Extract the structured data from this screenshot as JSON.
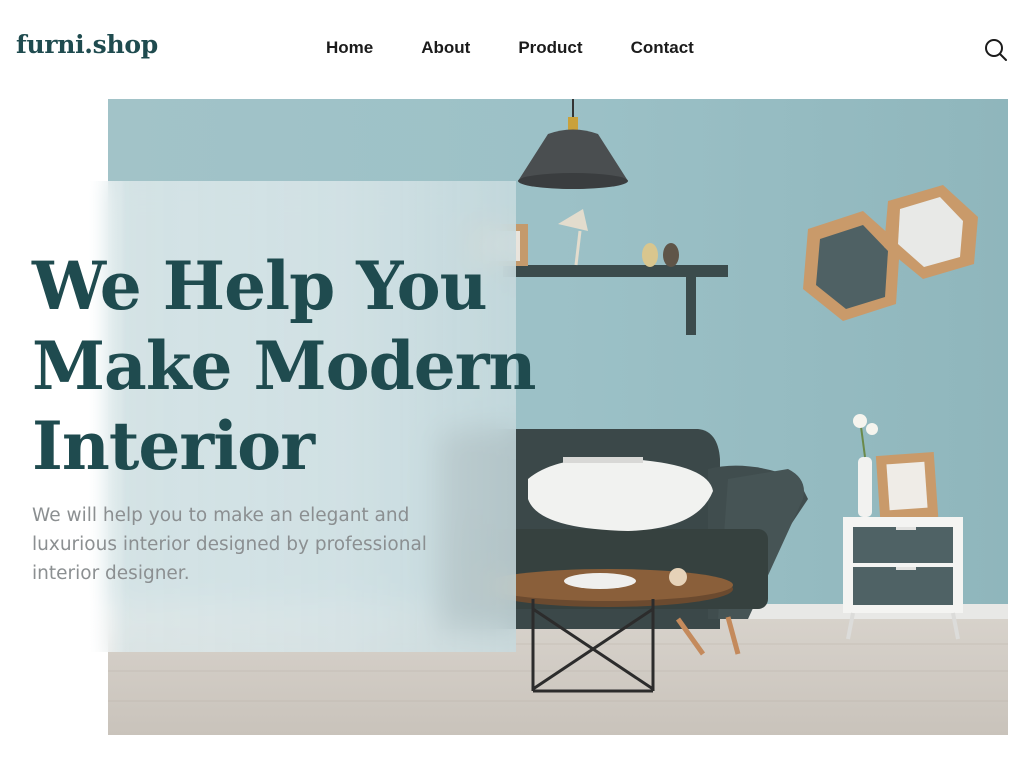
{
  "header": {
    "logo": "furni.shop",
    "nav": [
      {
        "label": "Home"
      },
      {
        "label": "About"
      },
      {
        "label": "Product"
      },
      {
        "label": "Contact"
      }
    ],
    "search_icon": "search-icon"
  },
  "hero": {
    "headline_lines": [
      "We Help You",
      "Make Modern",
      "Interior"
    ],
    "subtext": "We will help you to make an elegant and luxurious interior designed by professional interior designer.",
    "image": "living-room-photo",
    "colors": {
      "heading": "#1f4b4f",
      "wall": "#94bac0",
      "body_text": "#8b8f91"
    }
  }
}
